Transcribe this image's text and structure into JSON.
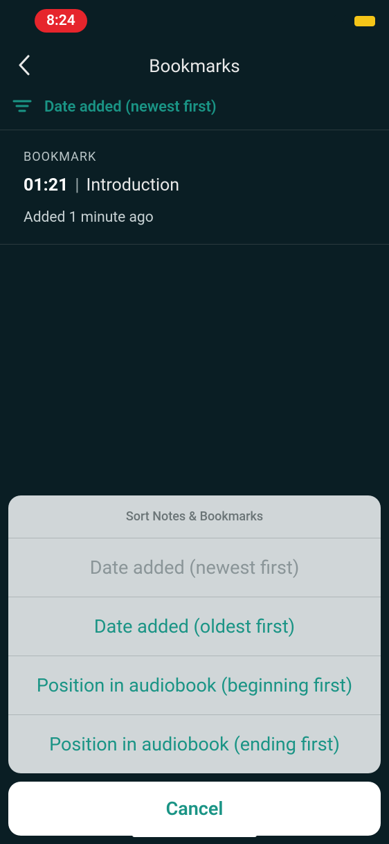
{
  "status_bar": {
    "time": "8:24"
  },
  "header": {
    "title": "Bookmarks"
  },
  "sort": {
    "current_label": "Date added (newest first)"
  },
  "bookmarks": [
    {
      "tag": "BOOKMARK",
      "timestamp": "01:21",
      "chapter": "Introduction",
      "age": "Added 1 minute ago"
    }
  ],
  "action_sheet": {
    "title": "Sort Notes & Bookmarks",
    "options": [
      {
        "label": "Date added (newest first)",
        "disabled": true
      },
      {
        "label": "Date added (oldest first)",
        "disabled": false
      },
      {
        "label": "Position in audiobook (beginning first)",
        "disabled": false
      },
      {
        "label": "Position in audiobook (ending first)",
        "disabled": false
      }
    ],
    "cancel": "Cancel"
  }
}
